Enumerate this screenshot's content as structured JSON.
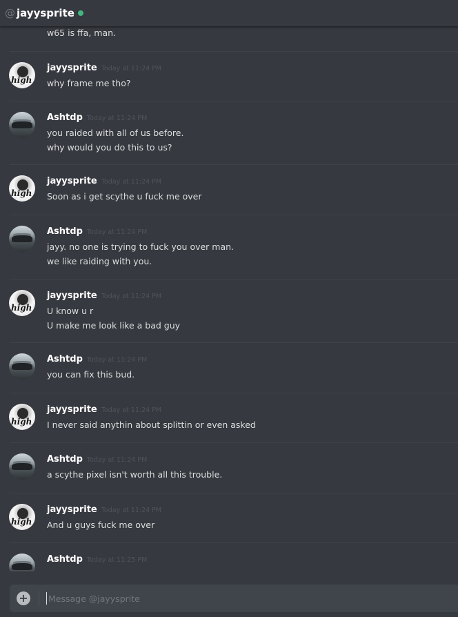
{
  "header": {
    "at_symbol": "@",
    "username": "jayysprite",
    "status_color": "#43b581"
  },
  "partial_message": "w65 is ffa, man.",
  "messages": [
    {
      "author": "jayysprite",
      "time": "Today at 11:24 PM",
      "lines": [
        "why frame me tho?"
      ]
    },
    {
      "author": "Ashtdp",
      "time": "Today at 11:24 PM",
      "lines": [
        "you raided with all of us before.",
        "why would you do this to us?"
      ]
    },
    {
      "author": "jayysprite",
      "time": "Today at 11:24 PM",
      "lines": [
        "Soon as i get scythe u fuck me over"
      ]
    },
    {
      "author": "Ashtdp",
      "time": "Today at 11:24 PM",
      "lines": [
        "jayy. no one is trying to fuck you over man.",
        "we like raiding with you."
      ]
    },
    {
      "author": "jayysprite",
      "time": "Today at 11:24 PM",
      "lines": [
        "U know u r",
        "U make me look like a bad guy"
      ]
    },
    {
      "author": "Ashtdp",
      "time": "Today at 11:24 PM",
      "lines": [
        "you can fix this bud."
      ]
    },
    {
      "author": "jayysprite",
      "time": "Today at 11:24 PM",
      "lines": [
        "I never said anythin about splittin or even asked"
      ]
    },
    {
      "author": "Ashtdp",
      "time": "Today at 11:24 PM",
      "lines": [
        "a scythe pixel isn't worth all this trouble."
      ]
    },
    {
      "author": "jayysprite",
      "time": "Today at 11:24 PM",
      "lines": [
        "And u guys fuck me over"
      ]
    },
    {
      "author": "Ashtdp",
      "time": "Today at 11:25 PM",
      "lines": []
    }
  ],
  "avatar_text": "high",
  "composer": {
    "placeholder": "Message @jayysprite",
    "plus_icon": "+"
  }
}
